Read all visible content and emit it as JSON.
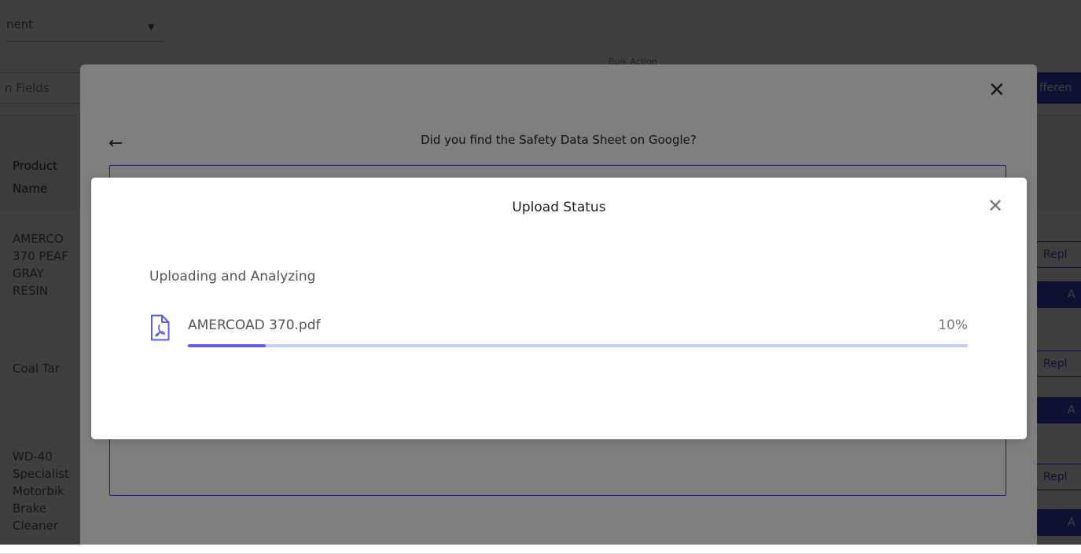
{
  "background": {
    "top_select": {
      "text": "nent",
      "caret": "▼"
    },
    "fields_button": "n Fields",
    "bulk_action_label": "Bulk Action",
    "difference_button": "fferen",
    "table": {
      "header_cell": "Product Name",
      "rows": [
        {
          "name_lines": [
            "AMERCO",
            "370 PEAF",
            "GRAY",
            "RESIN"
          ],
          "replace_label": "Repl",
          "add_label": "A"
        },
        {
          "name_lines": [
            "Coal Tar"
          ],
          "replace_label": "Repl",
          "add_label": "A"
        },
        {
          "name_lines": [
            "WD-40",
            "Specialist",
            "Motorbik",
            "Brake",
            "Cleaner"
          ],
          "replace_label": "Repl",
          "add_label": "A"
        }
      ]
    }
  },
  "sds_modal": {
    "question": "Did you find the Safety Data Sheet on Google?",
    "close_icon": "close-icon",
    "back_icon": "arrow-left-icon"
  },
  "upload_modal": {
    "title": "Upload Status",
    "close_icon": "close-icon",
    "section_title": "Uploading and Analyzing",
    "file": {
      "icon": "pdf-file-icon",
      "name": "AMERCOAD 370.pdf",
      "progress_label": "10%",
      "progress": 0.1
    },
    "colors": {
      "accent": "#5b5ee6",
      "track": "#c9cbf7"
    }
  }
}
